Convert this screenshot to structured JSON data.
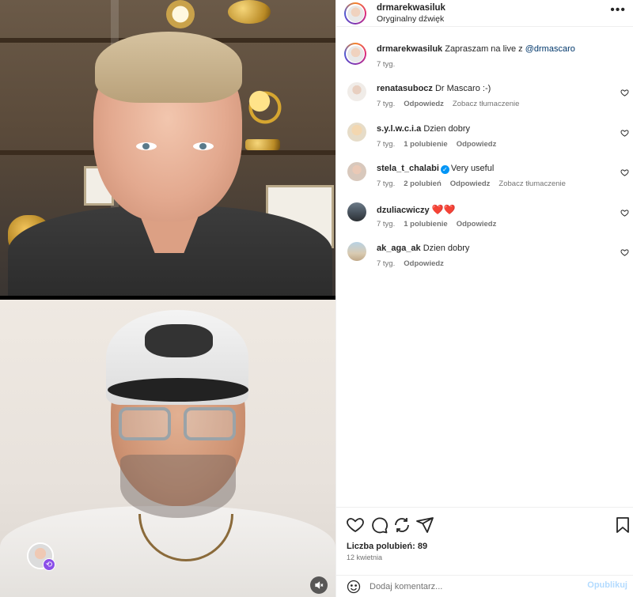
{
  "header": {
    "username": "drmarekwasiluk",
    "audio": "Oryginalny dźwięk",
    "more_icon": "more-horizontal-icon"
  },
  "caption": {
    "username": "drmarekwasiluk",
    "text": "Zapraszam na live z",
    "mention": "@drmascaro",
    "time": "7 tyg."
  },
  "comments": [
    {
      "username": "renatasubocz",
      "text": "Dr Mascaro :-)",
      "time": "7 tyg.",
      "likes": "",
      "reply": "Odpowiedz",
      "translate": "Zobacz tłumaczenie"
    },
    {
      "username": "s.y.l.w.c.i.a",
      "text": "Dzien dobry",
      "time": "7 tyg.",
      "likes": "1 polubienie",
      "reply": "Odpowiedz",
      "translate": ""
    },
    {
      "username": "stela_t_chalabi",
      "text": "Very useful",
      "time": "7 tyg.",
      "likes": "2 polubień",
      "reply": "Odpowiedz",
      "translate": "Zobacz tłumaczenie",
      "verified": true
    },
    {
      "username": "dzuliacwiczy",
      "text": "❤️❤️",
      "time": "7 tyg.",
      "likes": "1 polubienie",
      "reply": "Odpowiedz",
      "translate": ""
    },
    {
      "username": "ak_aga_ak",
      "text": "Dzien dobry",
      "time": "7 tyg.",
      "likes": "",
      "reply": "Odpowiedz",
      "translate": ""
    }
  ],
  "actions": {
    "likes_label": "Liczba polubień: 89",
    "date": "12 kwietnia"
  },
  "comment_box": {
    "placeholder": "Dodaj komentarz...",
    "publish": "Opublikuj"
  },
  "colors": {
    "link": "#00376b",
    "publish_disabled": "#b3dbff",
    "heart_red": "#ed1b3a",
    "verified": "#0095f6"
  }
}
